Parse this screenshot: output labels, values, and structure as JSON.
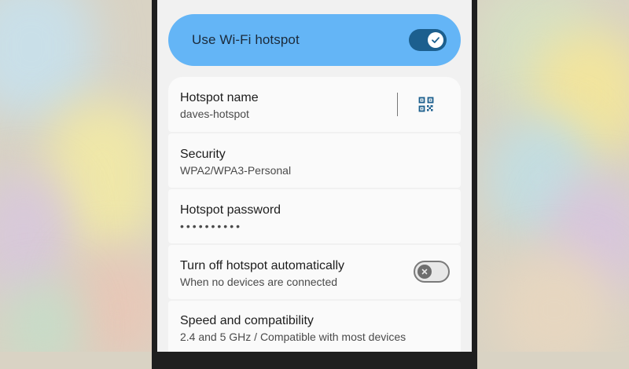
{
  "colors": {
    "accent": "#64b5f6",
    "switch_on": "#1c5f8e",
    "card_bg": "#fafafa",
    "screen_bg": "#f1f1f1"
  },
  "master_toggle": {
    "label": "Use Wi-Fi hotspot",
    "checked": true,
    "icon": "check-icon"
  },
  "settings": {
    "hotspot_name": {
      "title": "Hotspot name",
      "value": "daves-hotspot",
      "icon": "qr-code-icon"
    },
    "security": {
      "title": "Security",
      "value": "WPA2/WPA3-Personal"
    },
    "password": {
      "title": "Hotspot password",
      "value": "••••••••••"
    },
    "auto_off": {
      "title": "Turn off hotspot automatically",
      "subtitle": "When no devices are connected",
      "checked": false,
      "icon": "close-icon"
    },
    "speed": {
      "title": "Speed and compatibility",
      "value": "2.4 and 5 GHz / Compatible with most devices"
    }
  }
}
